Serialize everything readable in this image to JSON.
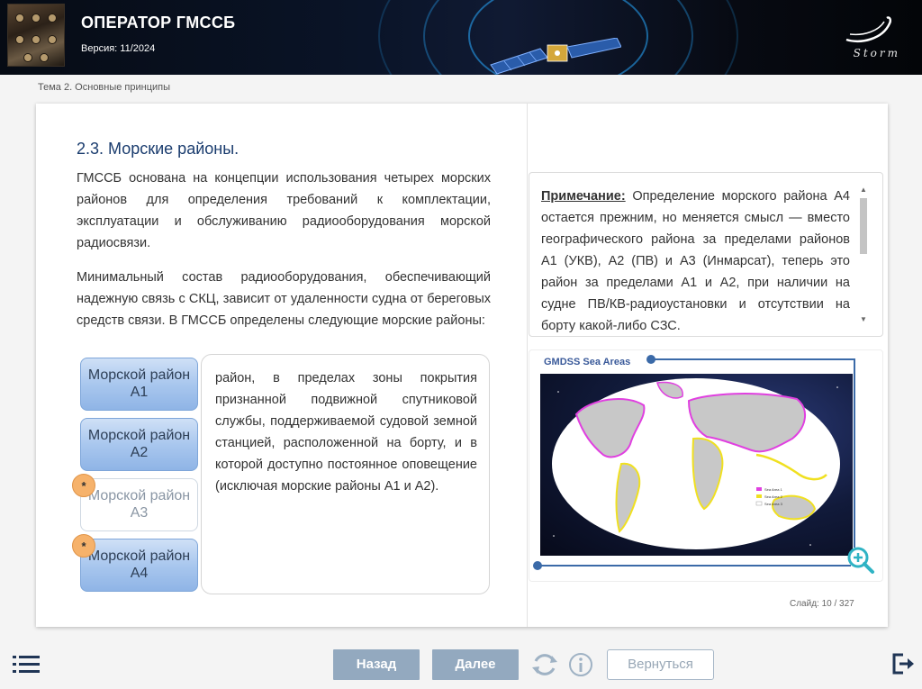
{
  "header": {
    "title": "ОПЕРАТОР ГМССБ",
    "version": "Версия: 11/2024",
    "brand": "Storm"
  },
  "breadcrumb": "Тема 2. Основные принципы",
  "section": {
    "title": "2.3. Морские районы.",
    "paragraph1": "ГМССБ основана на концепции использования четырех морских районов для определения требований к комплектации, эксплуатации и обслуживанию радиооборудования морской радиосвязи.",
    "paragraph2": "Минимальный состав радиооборудования, обеспечивающий надежную связь с СКЦ, зависит от удаленности судна от береговых средств связи. В ГМССБ определены следующие морские районы:"
  },
  "areas": [
    {
      "label": "Морской район А1",
      "badge": ""
    },
    {
      "label": "Морской район А2",
      "badge": ""
    },
    {
      "label": "Морской район А3",
      "badge": "*"
    },
    {
      "label": "Морской район А4",
      "badge": "*"
    }
  ],
  "description": "район, в пределах зоны покрытия признанной подвижной спутниковой службы, поддерживаемой судовой земной станцией, расположенной на борту, и в которой доступно постоянное оповещение (исключая морские районы А1 и А2).",
  "note": {
    "label": "Примечание:",
    "text": " Определение морского района А4 остается прежним, но меняется смысл — вместо географического района за пределами районов А1 (УКВ), А2 (ПВ) и А3 (Инмарсат), теперь это район за пределами А1 и А2, при наличии на судне ПВ/КВ-радиоустановки и отсутствии на борту какой-либо СЗС."
  },
  "map": {
    "title": "GMDSS Sea Areas",
    "legend": [
      "Sea Area 1",
      "Sea Area 2",
      "Sea Area 3"
    ],
    "colors": {
      "area1": "#e040e0",
      "area2": "#f0e020",
      "land": "#c8c8c8",
      "ocean": "#ffffff"
    }
  },
  "slide": {
    "text": "Слайд:  10 / 327"
  },
  "footer": {
    "back": "Назад",
    "next": "Далее",
    "return": "Вернуться",
    "icons": [
      "menu-icon",
      "refresh-icon",
      "info-icon",
      "exit-icon"
    ]
  }
}
